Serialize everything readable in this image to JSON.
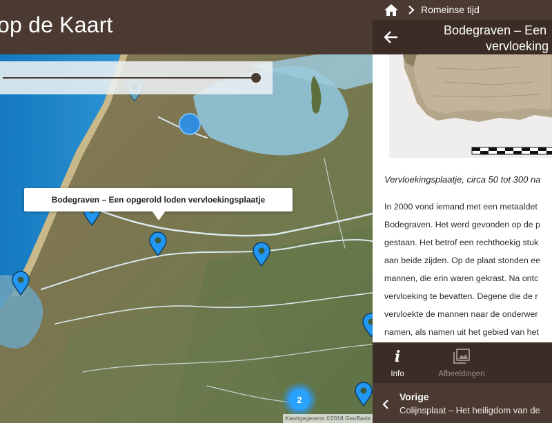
{
  "map": {
    "title": "op de Kaart",
    "popup_title": "Bodegraven – Een opgerold loden vervloekingsplaatje",
    "cluster_count": "2",
    "attribution": "Kaartgegevens ©2018 GeoBasis"
  },
  "panel": {
    "breadcrumb": "Romeinse tijd",
    "title_line1": "Bodegraven – Een",
    "title_line2": "vervloeking",
    "caption": "Vervloekingsplaatje, circa 50 tot 300 na",
    "paragraph_lines": [
      "In 2000 vond iemand met een metaaldet",
      "Bodegraven. Het werd gevonden op de p",
      "gestaan. Het betrof een rechthoekig stuk",
      "aan beide zijden. Op de plaat stonden ee",
      "mannen, die erin waren gekrast. Na ontc",
      "vervloeking te bevatten. Degene die de r",
      "vervloekte de mannen naar de onderwer",
      "namen, als namen uit het gebied van het"
    ]
  },
  "tabs": {
    "info_label": "Info",
    "images_label": "Afbeeldingen"
  },
  "previous": {
    "label": "Vorige",
    "title": "Colijnsplaat – Het heiligdom van de"
  },
  "icons": {
    "home": "home-icon",
    "breadcrumb_separator": "chevron-right-icon",
    "back": "arrow-left-icon",
    "info": "info-icon",
    "images": "images-icon",
    "previous": "chevron-left-icon",
    "marker": "map-marker-icon"
  },
  "colors": {
    "header_brown": "#4b3a31",
    "dark_brown": "#3b2d26",
    "marker_blue": "#2196f3",
    "sea_blue": "#1f86c6"
  }
}
